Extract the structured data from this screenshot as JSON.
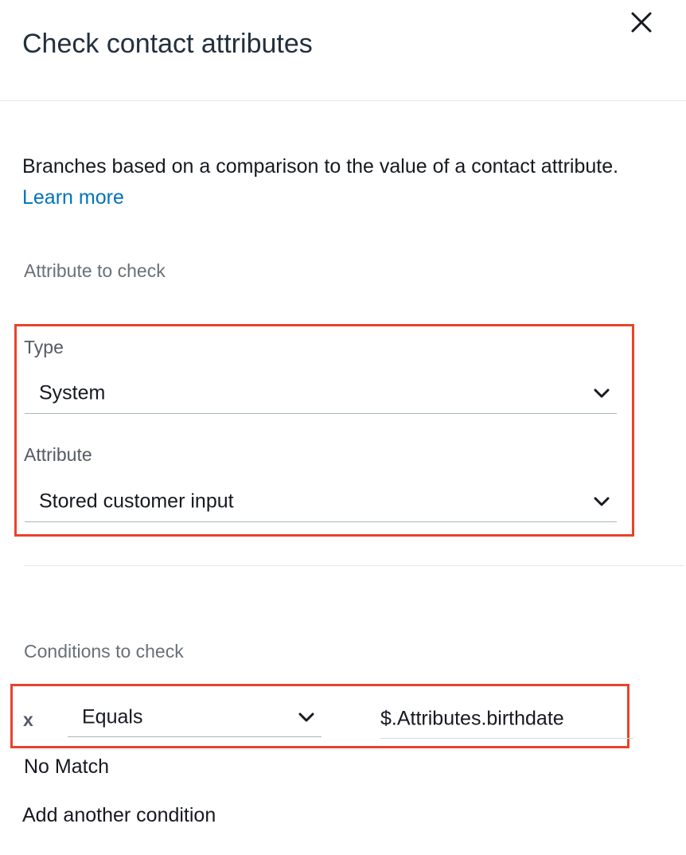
{
  "panel": {
    "title": "Check contact attributes",
    "close_icon": "close-icon"
  },
  "description": {
    "text": "Branches based on a comparison to the value of a contact attribute.",
    "learn_more": "Learn more"
  },
  "attribute_section": {
    "heading": "Attribute to check",
    "type_label": "Type",
    "type_value": "System",
    "attribute_label": "Attribute",
    "attribute_value": "Stored customer input"
  },
  "conditions_section": {
    "heading": "Conditions to check",
    "conditions": [
      {
        "remove": "x",
        "operator": "Equals",
        "value": "$.Attributes.birthdate"
      }
    ],
    "no_match": "No Match",
    "add_condition": "Add another condition"
  },
  "colors": {
    "highlight": "#e8432b",
    "link": "#0073bb"
  }
}
